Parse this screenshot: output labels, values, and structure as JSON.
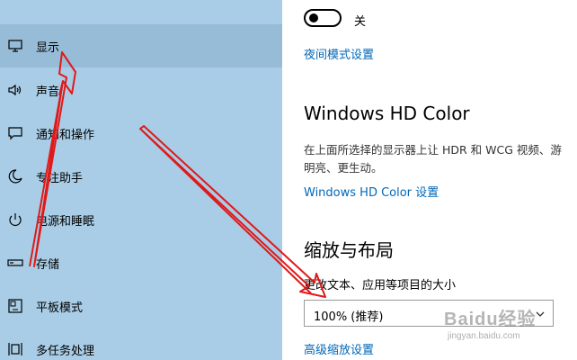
{
  "sidebar": {
    "items": [
      {
        "label": "显示",
        "icon": "monitor-icon",
        "selected": true
      },
      {
        "label": "声音",
        "icon": "speaker-icon",
        "selected": false
      },
      {
        "label": "通知和操作",
        "icon": "notification-icon",
        "selected": false
      },
      {
        "label": "专注助手",
        "icon": "moon-icon",
        "selected": false
      },
      {
        "label": "电源和睡眠",
        "icon": "power-icon",
        "selected": false
      },
      {
        "label": "存储",
        "icon": "storage-icon",
        "selected": false
      },
      {
        "label": "平板模式",
        "icon": "tablet-icon",
        "selected": false
      },
      {
        "label": "多任务处理",
        "icon": "multitask-icon",
        "selected": false
      }
    ]
  },
  "main": {
    "night_light": {
      "state": "关",
      "on": false
    },
    "night_light_settings_link": "夜间模式设置",
    "hd_color": {
      "title": "Windows HD Color",
      "description_line1": "在上面所选择的显示器上让 HDR 和 WCG 视频、游",
      "description_line2": "明亮、更生动。",
      "settings_link": "Windows HD Color 设置"
    },
    "scale_layout": {
      "title": "缩放与布局",
      "size_label": "更改文本、应用等项目的大小",
      "size_value": "100% (推荐)",
      "advanced_link": "高级缩放设置"
    }
  },
  "watermark": {
    "text": "Baidu经验",
    "sub": "jingyan.baidu.com"
  },
  "colors": {
    "sidebar_bg": "#a9cde6",
    "selected_bg": "#97bcd7",
    "link": "#0067b8",
    "annotation": "#e01919"
  }
}
